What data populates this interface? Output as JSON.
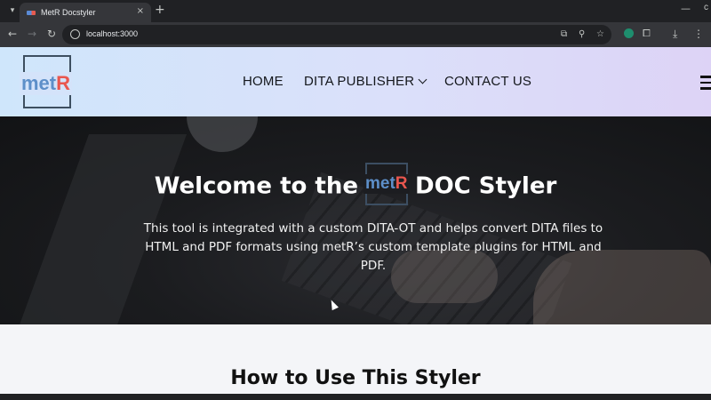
{
  "browser": {
    "tab_title": "MetR Docstyler",
    "tab_close": "×",
    "new_tab": "+",
    "minimize": "—",
    "window_extra": "c",
    "url": "localhost:3000",
    "icons": {
      "tab_search": "tab-search-icon",
      "back": "back-arrow-icon",
      "forward": "forward-arrow-icon",
      "reload": "reload-icon",
      "site_info": "site-info-icon",
      "install": "install-app-icon",
      "zoom": "zoom-icon",
      "bookmark": "star-icon",
      "extension": "extension-icon",
      "extensions_menu": "puzzle-icon",
      "downloads": "download-icon",
      "menu": "kebab-menu-icon"
    }
  },
  "site": {
    "logo": {
      "part1": "met",
      "part2": "R",
      "color1": "#5d8fc9",
      "color2": "#e9564e"
    },
    "nav": {
      "home": "HOME",
      "dita_publisher": "DITA PUBLISHER",
      "contact": "CONTACT US"
    },
    "hero": {
      "title_before": "Welcome to the",
      "title_after": "DOC Styler",
      "description": "This tool is integrated with a custom DITA-OT and helps convert DITA files to HTML and PDF formats using metR’s custom template plugins for HTML and PDF."
    },
    "section_title": "How to Use This Styler"
  }
}
